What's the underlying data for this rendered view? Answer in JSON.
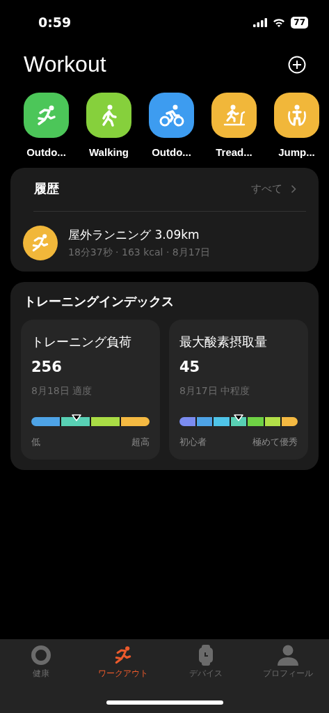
{
  "status_bar": {
    "time": "0:59",
    "battery": "77"
  },
  "header": {
    "title": "Workout"
  },
  "workouts": [
    {
      "label": "Outdo...",
      "kind": "run",
      "color": "#4cc659"
    },
    {
      "label": "Walking",
      "kind": "walk",
      "color": "#86d03c"
    },
    {
      "label": "Outdo...",
      "kind": "bike",
      "color": "#3d9cf0"
    },
    {
      "label": "Tread...",
      "kind": "treadmill",
      "color": "#f1b73a"
    },
    {
      "label": "Jump...",
      "kind": "rope",
      "color": "#f1b73a"
    }
  ],
  "history": {
    "title": "履歴",
    "link": "すべて",
    "items": [
      {
        "title": "屋外ランニング 3.09km",
        "detail": "18分37秒 · 163 kcal · 8月17日",
        "kind": "run"
      }
    ]
  },
  "training_index": {
    "title": "トレーニングインデックス",
    "cards": [
      {
        "title": "トレーニング負荷",
        "value": "256",
        "detail": "8月18日 適度",
        "level": 0.38,
        "min_label": "低",
        "max_label": "超高",
        "segments": [
          {
            "color": "#4ea3e6"
          },
          {
            "color": "#58d0b4"
          },
          {
            "color": "#a9dc45"
          },
          {
            "color": "#f4b942"
          }
        ]
      },
      {
        "title": "最大酸素摂取量",
        "value": "45",
        "detail": "8月17日 中程度",
        "level": 0.5,
        "min_label": "初心者",
        "max_label": "極めて優秀",
        "segments": [
          {
            "color": "#7b8cf0"
          },
          {
            "color": "#4ea3e6"
          },
          {
            "color": "#4fc4e8"
          },
          {
            "color": "#58d0b4"
          },
          {
            "color": "#6fd245"
          },
          {
            "color": "#b2df48"
          },
          {
            "color": "#f4b942"
          }
        ]
      }
    ]
  },
  "tabs": [
    {
      "label": "健康",
      "kind": "health",
      "selected": false
    },
    {
      "label": "ワークアウト",
      "kind": "workout",
      "selected": true
    },
    {
      "label": "デバイス",
      "kind": "device",
      "selected": false
    },
    {
      "label": "プロフィール",
      "kind": "profile",
      "selected": false
    }
  ]
}
